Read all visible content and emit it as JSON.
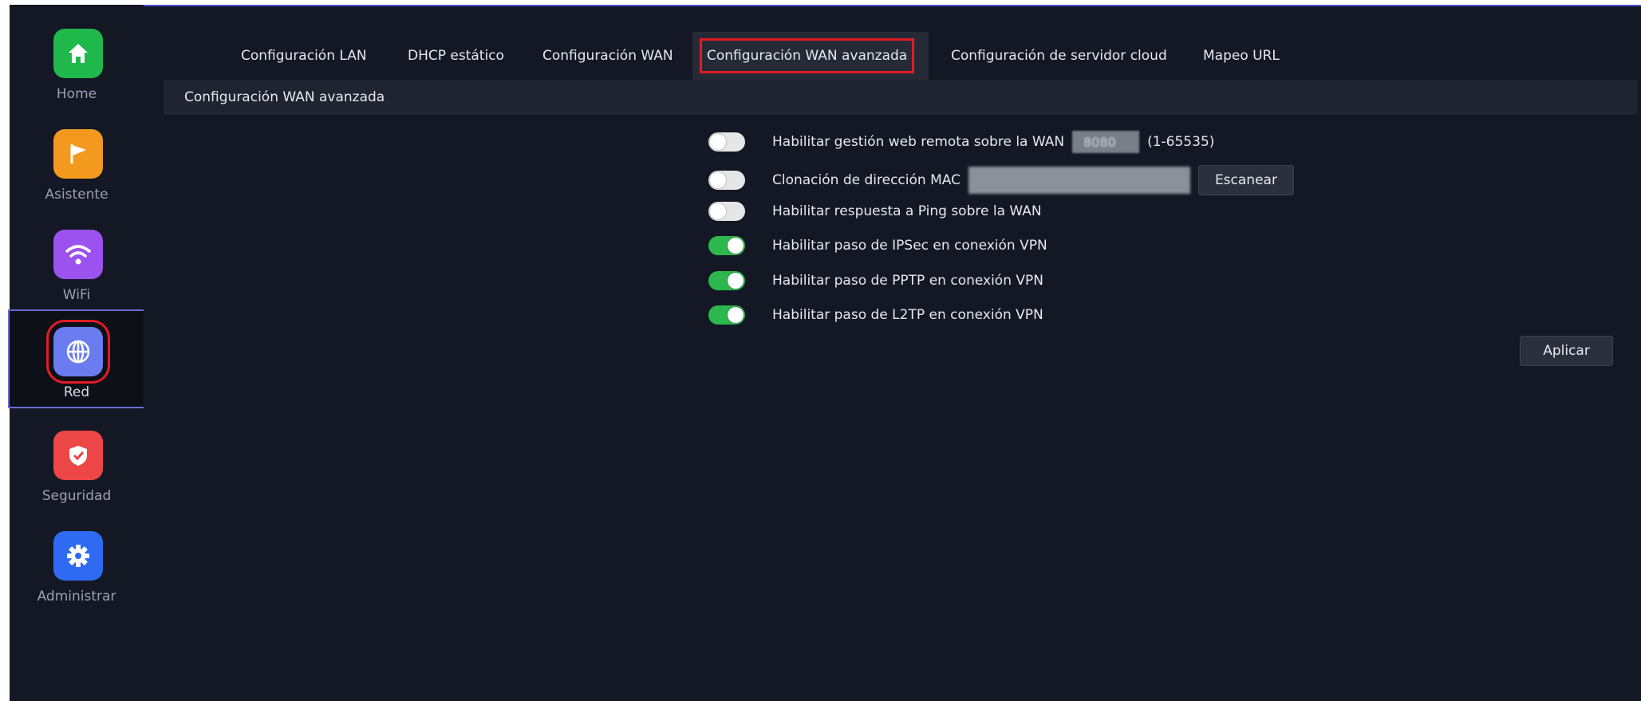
{
  "sidebar": {
    "items": [
      {
        "label": "Home",
        "icon": "home-icon",
        "color": "#1fb84a"
      },
      {
        "label": "Asistente",
        "icon": "flag-icon",
        "color": "#f39a1e"
      },
      {
        "label": "WiFi",
        "icon": "wifi-icon",
        "color": "#9b52ee"
      },
      {
        "label": "Red",
        "icon": "globe-icon",
        "color": "#6b7cf0",
        "active": true
      },
      {
        "label": "Seguridad",
        "icon": "shield-icon",
        "color": "#ec4646"
      },
      {
        "label": "Administrar",
        "icon": "gear-icon",
        "color": "#2f6bf2"
      }
    ]
  },
  "tabs": [
    {
      "label": "Configuración LAN"
    },
    {
      "label": "DHCP estático"
    },
    {
      "label": "Configuración WAN"
    },
    {
      "label": "Configuración WAN avanzada",
      "active": true
    },
    {
      "label": "Configuración de servidor cloud"
    },
    {
      "label": "Mapeo URL"
    }
  ],
  "section": {
    "title": "Configuración WAN avanzada"
  },
  "settings": {
    "remote_web": {
      "label": "Habilitar gestión web remota sobre la WAN",
      "enabled": false,
      "port": "8080",
      "range": "(1-65535)"
    },
    "mac_clone": {
      "label": "Clonación de dirección MAC",
      "enabled": false,
      "scan_label": "Escanear"
    },
    "ping": {
      "label": "Habilitar respuesta a Ping sobre la WAN",
      "enabled": false
    },
    "ipsec": {
      "label": "Habilitar paso de IPSec en conexión VPN",
      "enabled": true
    },
    "pptp": {
      "label": "Habilitar paso de PPTP en conexión VPN",
      "enabled": true
    },
    "l2tp": {
      "label": "Habilitar paso de L2TP en conexión VPN",
      "enabled": true
    }
  },
  "apply_label": "Aplicar",
  "colors": {
    "accent_red": "#e21b24",
    "toggle_on": "#2db84d",
    "panel_bg": "#141824"
  }
}
